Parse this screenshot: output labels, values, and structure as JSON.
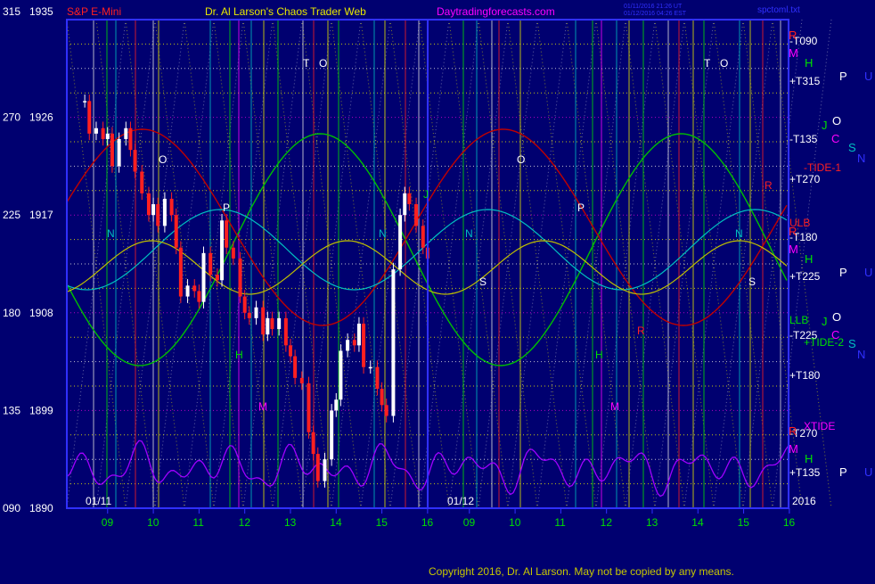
{
  "header": {
    "instrument": "S&P E-Mini",
    "author": "Dr. Al Larson's Chaos Trader Web",
    "site": "Daytradingforecasts.com",
    "timestamp_line1": "01/11/2016 21:26 UT",
    "timestamp_line2": "01/12/2016 04:26 EST",
    "file_name": "spctoml.txt"
  },
  "footer": {
    "copyright": "Copyright 2016, Dr. Al Larson. May not be copied by any means."
  },
  "colors": {
    "background": "#000070",
    "price_up": "#ffffff",
    "price_down": "#ff2020",
    "grid_white": "#e0e0e0",
    "grid_yellow": "#e8e800",
    "grid_magenta": "#d000d0",
    "grid_green": "#00c000",
    "axis_blue": "#3030ff",
    "curve_red": "#c00000",
    "curve_green": "#00c000",
    "curve_cyan": "#00c0c0",
    "curve_yellow": "#c0c000",
    "curve_purple": "#a000ff"
  },
  "chart_data": {
    "type": "candlestick",
    "title": "S&P E-Mini",
    "y_axis": {
      "left_degree_labels": [
        "315",
        "270",
        "225",
        "180",
        "135",
        "090"
      ],
      "price_labels": [
        "1935",
        "1926",
        "1917",
        "1908",
        "1899",
        "1890"
      ],
      "price_values": [
        1935,
        1926,
        1917,
        1908,
        1899,
        1890
      ],
      "ylim": [
        1890,
        1935
      ]
    },
    "x_axis": {
      "hour_ticks": [
        "09",
        "10",
        "11",
        "12",
        "13",
        "14",
        "15",
        "16",
        "09",
        "10",
        "11",
        "12",
        "13",
        "14",
        "15",
        "16"
      ],
      "date_labels": [
        "01/11",
        "01/12"
      ],
      "year_label": "2016"
    },
    "series": [
      {
        "date": "01/11",
        "hours": [
          8.5,
          8.6,
          8.75,
          8.9,
          9.0,
          9.1,
          9.25,
          9.4,
          9.5,
          9.6,
          9.75,
          9.9,
          10.0,
          10.1,
          10.25,
          10.4,
          10.5,
          10.6,
          10.75,
          10.9,
          11.0,
          11.1,
          11.25,
          11.4,
          11.5,
          11.6,
          11.75,
          11.9,
          12.0,
          12.1,
          12.25,
          12.4,
          12.5,
          12.6,
          12.75,
          12.9,
          13.0,
          13.1,
          13.25,
          13.4,
          13.5,
          13.6,
          13.75,
          13.9,
          14.0,
          14.1,
          14.25,
          14.4,
          14.5,
          14.6,
          14.75,
          14.9,
          15.0,
          15.1,
          15.25,
          15.4,
          15.5,
          15.6,
          15.75,
          15.9,
          16.0
        ],
        "close": [
          1927.5,
          1924.5,
          1925.0,
          1924.0,
          1924.5,
          1921.5,
          1924.0,
          1925.0,
          1923.0,
          1921.0,
          1919.0,
          1917.0,
          1918.0,
          1916.0,
          1918.5,
          1917.0,
          1914.0,
          1909.5,
          1910.5,
          1910.0,
          1909.0,
          1913.5,
          1911.5,
          1911.0,
          1916.5,
          1914.0,
          1913.0,
          1909.5,
          1908.0,
          1907.5,
          1908.5,
          1906.0,
          1907.5,
          1906.5,
          1907.5,
          1905.0,
          1904.0,
          1902.0,
          1901.5,
          1897.0,
          1895.0,
          1892.5,
          1894.5,
          1899.0,
          1900.0,
          1904.5,
          1905.5,
          1905.0,
          1907.0,
          1903.0,
          1903.0,
          1901.0,
          1899.5,
          1898.5,
          1912.0,
          1917.0,
          1919.0,
          1918.0,
          1916.0,
          1914.0,
          1913.0
        ]
      }
    ],
    "horizontal_line_labels": [
      {
        "text": "-T090",
        "color": "#ffffff"
      },
      {
        "text": "+T315",
        "color": "#ffffff"
      },
      {
        "text": "-T135",
        "color": "#ffffff"
      },
      {
        "text": "+T270",
        "color": "#ffffff"
      },
      {
        "text": "-T180",
        "color": "#ffffff"
      },
      {
        "text": "+T225",
        "color": "#ffffff"
      },
      {
        "text": "-T225",
        "color": "#ffffff"
      },
      {
        "text": "+T180",
        "color": "#ffffff"
      },
      {
        "text": "-T270",
        "color": "#ffffff"
      },
      {
        "text": "+T135",
        "color": "#ffffff"
      },
      {
        "text": "ULB",
        "color": "#ff2020"
      },
      {
        "text": "LLB",
        "color": "#00e000"
      },
      {
        "text": "-TIDE-1",
        "color": "#ff2020"
      },
      {
        "text": "+TIDE-2",
        "color": "#00e000"
      },
      {
        "text": "XTIDE",
        "color": "#ff00ff"
      }
    ],
    "planet_labels": {
      "right_group_1": [
        {
          "text": "R",
          "color": "#ff2020"
        },
        {
          "text": "M",
          "color": "#ff00ff"
        },
        {
          "text": "H",
          "color": "#00e000"
        },
        {
          "text": "P",
          "color": "#ffffff"
        },
        {
          "text": "U",
          "color": "#3030ff"
        }
      ],
      "right_group_2": [
        {
          "text": "J",
          "color": "#00e000"
        },
        {
          "text": "O",
          "color": "#ffffff"
        },
        {
          "text": "C",
          "color": "#ff00ff"
        },
        {
          "text": "S",
          "color": "#00c0c0"
        },
        {
          "text": "N",
          "color": "#3030ff"
        }
      ],
      "in_chart": [
        {
          "text": "T",
          "color": "#ffffff"
        },
        {
          "text": "O",
          "color": "#ffffff"
        },
        {
          "text": "N",
          "color": "#00c0c0"
        },
        {
          "text": "O",
          "color": "#ffffff"
        },
        {
          "text": "P",
          "color": "#ffffff"
        },
        {
          "text": "H",
          "color": "#00e000"
        },
        {
          "text": "M",
          "color": "#ff00ff"
        },
        {
          "text": "S",
          "color": "#ffffff"
        },
        {
          "text": "J",
          "color": "#00e000"
        },
        {
          "text": "R",
          "color": "#ff2020"
        }
      ]
    }
  }
}
